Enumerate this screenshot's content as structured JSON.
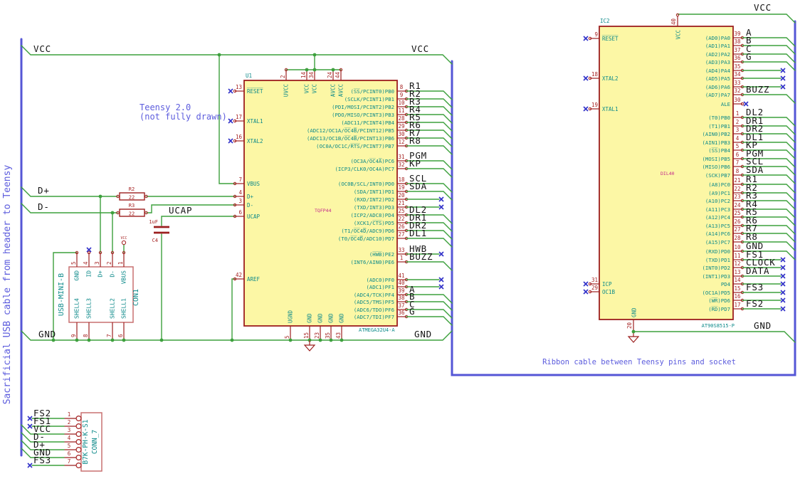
{
  "colors": {
    "wire": "#3da03d",
    "bus": "#5456d6",
    "outline": "#9c1f1f",
    "pin_name": "#0d8a8a",
    "pin_number": "#a62323",
    "body_fill": "#fcf7a5",
    "label": "#141414",
    "note": "#5c5cdd",
    "footprint": "#c42a8c",
    "no_connect": "#3030c8",
    "connector_outline": "#c97070"
  },
  "notes": {
    "usb_cable": "Sacrificial USB cable from header to Teensy",
    "teensy_line1": "Teensy 2.0",
    "teensy_line2": "(not fully drawn)",
    "ribbon": "Ribbon cable between Teensy pins and socket"
  },
  "power": {
    "vcc": "VCC",
    "gnd": "GND"
  },
  "nets": {
    "ucap": "UCAP",
    "dplus": "D+",
    "dminus": "D-"
  },
  "u1": {
    "ref": "U1",
    "value": "ATMEGA32U4-A",
    "footprint": "TQFP44",
    "top_pins": [
      {
        "num": "2",
        "name": "UVCC"
      },
      {
        "num": "14",
        "name": "VCC"
      },
      {
        "num": "34",
        "name": "VCC"
      },
      {
        "num": "24",
        "name": "AVCC"
      },
      {
        "num": "44",
        "name": "AVCC"
      }
    ],
    "bottom_pins": [
      {
        "num": "5",
        "name": "UGND"
      },
      {
        "num": "15",
        "name": "GND"
      },
      {
        "num": "23",
        "name": "GND"
      },
      {
        "num": "35",
        "name": "GND"
      },
      {
        "num": "43",
        "name": "GND"
      }
    ],
    "left_pins": [
      {
        "num": "13",
        "name": "R̅E̅S̅E̅T̅",
        "nc": true
      },
      {
        "num": "17",
        "name": "XTAL1",
        "nc": true
      },
      {
        "num": "16",
        "name": "XTAL2",
        "nc": true
      },
      {
        "num": "7",
        "name": "VBUS"
      },
      {
        "num": "4",
        "name": "D+"
      },
      {
        "num": "3",
        "name": "D-"
      },
      {
        "num": "6",
        "name": "UCAP"
      },
      {
        "num": "42",
        "name": "AREF"
      }
    ],
    "right_groups": [
      {
        "pins": [
          {
            "num": "8",
            "name": "(S̅S̅/PCINT0)PB0",
            "label": "R1"
          },
          {
            "num": "9",
            "name": "(SCLK/PCINT1)PB1",
            "label": "R2"
          },
          {
            "num": "10",
            "name": "(PDI/MOSI/PCINT2)PB2",
            "label": "R3"
          },
          {
            "num": "11",
            "name": "(PDO/MISO/PCINT3)PB3",
            "label": "R4"
          },
          {
            "num": "28",
            "name": "(ADC11/PCINT4)PB4",
            "label": "R5"
          },
          {
            "num": "29",
            "name": "(ADC12/OC1A/O̅C̅4̅B̅/PCINT12)PB5",
            "label": "R6"
          },
          {
            "num": "30",
            "name": "(ADC13/OC1B/O̅C̅4̅B̅/PCINT13)PB6",
            "label": "R7"
          },
          {
            "num": "12",
            "name": "(OC0A/OC1C/R̅T̅S̅/PCINT7)PB7",
            "label": "R8"
          }
        ]
      },
      {
        "pins": [
          {
            "num": "31",
            "name": "(OC3A/O̅C̅4̅A̅)PC6",
            "label": "PGM"
          },
          {
            "num": "32",
            "name": "(ICP3/CLK0/OC4A)PC7",
            "label": "KP"
          }
        ]
      },
      {
        "pins": [
          {
            "num": "18",
            "name": "(OC0B/SCL/INT0)PD0",
            "label": "SCL"
          },
          {
            "num": "19",
            "name": "(SDA/INT1)PD1",
            "label": "SDA"
          },
          {
            "num": "20",
            "name": "(RXD/INT2)PD2",
            "nc": true
          },
          {
            "num": "21",
            "name": "(TXD/INT3)PD3",
            "nc": true
          },
          {
            "num": "25",
            "name": "(ICP2/ADC8)PD4",
            "label": "DL2"
          },
          {
            "num": "22",
            "name": "(XCK1/C̅T̅S̅)PD5",
            "label": "DR1"
          },
          {
            "num": "26",
            "name": "(T1/O̅C̅4̅D̅/ADC9)PD6",
            "label": "DR2"
          },
          {
            "num": "27",
            "name": "(T0/O̅C̅4̅D̅/ADC10)PD7",
            "label": "DL1"
          }
        ]
      },
      {
        "pins": [
          {
            "num": "33",
            "name": "(H̅W̅B̅)PE2",
            "label": "HWB",
            "nc": true
          },
          {
            "num": "1",
            "name": "(INT6/AIN0)PE6",
            "label": "BUZZ"
          }
        ]
      },
      {
        "pins": [
          {
            "num": "41",
            "name": "(ADC0)PF0",
            "nc": true
          },
          {
            "num": "40",
            "name": "(ADC1)PF1",
            "nc": true
          },
          {
            "num": "39",
            "name": "(ADC4/TCK)PF4",
            "label": "A"
          },
          {
            "num": "38",
            "name": "(ADC5/TMS)PF5",
            "label": "B"
          },
          {
            "num": "37",
            "name": "(ADC6/TDO)PF6",
            "label": "C"
          },
          {
            "num": "36",
            "name": "(ADC7/TDI)PF7",
            "label": "G"
          }
        ]
      }
    ]
  },
  "ic2": {
    "ref": "IC2",
    "value": "AT90S8515-P",
    "package": "DIL40",
    "top_pin": {
      "num": "40",
      "name": "VCC"
    },
    "bottom_pin": {
      "num": "20",
      "name": "GND"
    },
    "left_pins": [
      {
        "num": "9",
        "name": "R̅E̅S̅E̅T̅",
        "nc": true
      },
      {
        "num": "18",
        "name": "XTAL2",
        "nc": true
      },
      {
        "num": "19",
        "name": "XTAL1",
        "nc": true
      },
      {
        "num": "31",
        "name": "ICP",
        "nc": true
      },
      {
        "num": "29",
        "name": "OC1B",
        "nc": true
      }
    ],
    "right_groups": [
      {
        "pins": [
          {
            "num": "39",
            "name": "(AD0)PA0",
            "label": "A"
          },
          {
            "num": "38",
            "name": "(AD1)PA1",
            "label": "B"
          },
          {
            "num": "37",
            "name": "(AD2)PA2",
            "label": "C"
          },
          {
            "num": "36",
            "name": "(AD3)PA3",
            "label": "G"
          },
          {
            "num": "35",
            "name": "(AD4)PA4",
            "nc": true
          },
          {
            "num": "34",
            "name": "(AD5)PA5",
            "nc": true
          },
          {
            "num": "33",
            "name": "(AD6)PA6",
            "nc": true
          },
          {
            "num": "32",
            "name": "(AD7)PA7",
            "label": "BUZZ"
          }
        ]
      },
      {
        "pins": [
          {
            "num": "30",
            "name": "ALE",
            "nc": true,
            "nc_at_pin": true
          }
        ]
      },
      {
        "pins": [
          {
            "num": "1",
            "name": "(T0)PB0",
            "label": "DL2"
          },
          {
            "num": "2",
            "name": "(T1)PB1",
            "label": "DR1"
          },
          {
            "num": "3",
            "name": "(AIN0)PB2",
            "label": "DR2"
          },
          {
            "num": "4",
            "name": "(AIN1)PB3",
            "label": "DL1"
          },
          {
            "num": "5",
            "name": "(S̅S̅)PB4",
            "label": "KP"
          },
          {
            "num": "6",
            "name": "(MOSI)PB5",
            "label": "PGM"
          },
          {
            "num": "7",
            "name": "(MISO)PB6",
            "label": "SCL"
          },
          {
            "num": "8",
            "name": "(SCK)PB7",
            "label": "SDA"
          }
        ]
      },
      {
        "pins": [
          {
            "num": "21",
            "name": "(A8)PC0",
            "label": "R1"
          },
          {
            "num": "22",
            "name": "(A9)PC1",
            "label": "R2"
          },
          {
            "num": "23",
            "name": "(A10)PC2",
            "label": "R3"
          },
          {
            "num": "24",
            "name": "(A11)PC3",
            "label": "R4"
          },
          {
            "num": "25",
            "name": "(A12)PC4",
            "label": "R5"
          },
          {
            "num": "26",
            "name": "(A13)PC5",
            "label": "R6"
          },
          {
            "num": "27",
            "name": "(A14)PC6",
            "label": "R7"
          },
          {
            "num": "28",
            "name": "(A15)PC7",
            "label": "R8"
          }
        ]
      },
      {
        "pins": [
          {
            "num": "10",
            "name": "(RXD)PD0",
            "label": "GND"
          },
          {
            "num": "11",
            "name": "(TXD)PD1",
            "label": "FS1",
            "nc": true
          },
          {
            "num": "12",
            "name": "(INT0)PD2",
            "label": "CLOCK",
            "nc": true
          },
          {
            "num": "13",
            "name": "(INT1)PD3",
            "label": "DATA",
            "nc": true
          },
          {
            "num": "14",
            "name": "PD4",
            "nc": true
          },
          {
            "num": "15",
            "name": "(OC1A)PD5",
            "label": "FS3",
            "nc": true
          },
          {
            "num": "16",
            "name": "(W̅R̅)PD6",
            "nc": true
          },
          {
            "num": "17",
            "name": "(R̅D̅)PD7",
            "label": "FS2",
            "nc": true
          }
        ]
      }
    ]
  },
  "con1": {
    "ref": "CON1",
    "value": "USB-MINI-B",
    "top_pins": [
      {
        "num": "5",
        "name": "GND"
      },
      {
        "num": "4",
        "name": "ID",
        "nc": true
      },
      {
        "num": "3",
        "name": "D+"
      },
      {
        "num": "2",
        "name": "D-"
      },
      {
        "num": "1",
        "name": "VBUS"
      }
    ],
    "shell_pins": [
      {
        "num": "9",
        "name": "SHELL4"
      },
      {
        "num": "8",
        "name": "SHELL3"
      },
      {
        "num": "7",
        "name": "SHELL2"
      },
      {
        "num": "6",
        "name": "SHELL1"
      }
    ]
  },
  "conn7": {
    "ref": "CONN_7",
    "value": "B7K-PH-K-S1",
    "pins": [
      {
        "num": "1",
        "label": "FS2",
        "nc": true
      },
      {
        "num": "2",
        "label": "FS1",
        "nc": true
      },
      {
        "num": "3",
        "label": "VCC"
      },
      {
        "num": "4",
        "label": "D-"
      },
      {
        "num": "5",
        "label": "D+"
      },
      {
        "num": "6",
        "label": "GND"
      },
      {
        "num": "7",
        "label": "FS3",
        "nc": true
      }
    ]
  },
  "r2": {
    "ref": "R2",
    "value": "22"
  },
  "r3": {
    "ref": "R3",
    "value": "22"
  },
  "c4": {
    "ref": "C4",
    "value": "1uF"
  }
}
